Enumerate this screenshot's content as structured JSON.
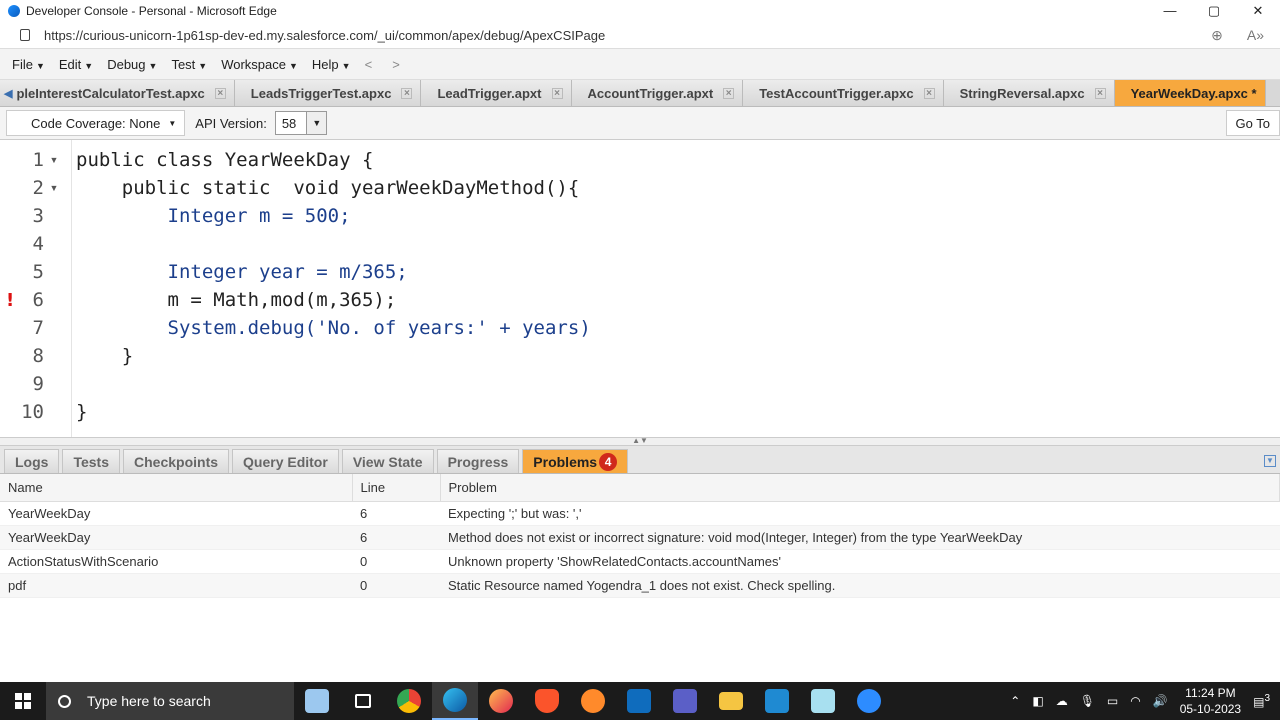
{
  "window": {
    "title": "Developer Console - Personal - Microsoft Edge",
    "controls": [
      "—",
      "▢",
      "✕"
    ]
  },
  "address": {
    "url": "https://curious-unicorn-1p61sp-dev-ed.my.salesforce.com/_ui/common/apex/debug/ApexCSIPage",
    "zoom_icon": "⊕",
    "read_icon": "A»"
  },
  "menu": {
    "items": [
      "File",
      "Edit",
      "Debug",
      "Test",
      "Workspace",
      "Help"
    ],
    "back": "<",
    "forward": ">"
  },
  "tabs": [
    {
      "label": "pleInterestCalculatorTest.apxc",
      "active": false
    },
    {
      "label": "LeadsTriggerTest.apxc",
      "active": false
    },
    {
      "label": "LeadTrigger.apxt",
      "active": false
    },
    {
      "label": "AccountTrigger.apxt",
      "active": false
    },
    {
      "label": "TestAccountTrigger.apxc",
      "active": false
    },
    {
      "label": "StringReversal.apxc",
      "active": false
    },
    {
      "label": "YearWeekDay.apxc *",
      "active": true
    }
  ],
  "toolbar": {
    "coverage": "Code Coverage: None",
    "api_label": "API Version:",
    "api_value": "58",
    "goto": "Go To"
  },
  "editor": {
    "line_numbers": [
      "1",
      "2",
      "3",
      "4",
      "5",
      "6",
      "7",
      "8",
      "9",
      "10"
    ],
    "error_marker": "!",
    "lines": [
      "public class YearWeekDay {",
      "    public static  void yearWeekDayMethod(){",
      "        Integer m = 500;",
      "",
      "        Integer year = m/365;",
      "        m = Math,mod(m,365);",
      "        System.debug('No. of years:' + years)",
      "    }",
      "",
      "}"
    ]
  },
  "panel": {
    "tabs": [
      "Logs",
      "Tests",
      "Checkpoints",
      "Query Editor",
      "View State",
      "Progress",
      "Problems"
    ],
    "problems_count": "4",
    "columns": [
      "Name",
      "Line",
      "Problem"
    ],
    "rows": [
      {
        "name": "YearWeekDay",
        "line": "6",
        "problem": "Expecting ';' but was: ','"
      },
      {
        "name": "YearWeekDay",
        "line": "6",
        "problem": "Method does not exist or incorrect signature: void mod(Integer, Integer) from the type YearWeekDay"
      },
      {
        "name": "ActionStatusWithScenario",
        "line": "0",
        "problem": "Unknown property 'ShowRelatedContacts.accountNames'"
      },
      {
        "name": "pdf",
        "line": "0",
        "problem": "Static Resource named Yogendra_1 does not exist. Check spelling."
      }
    ]
  },
  "taskbar": {
    "search_placeholder": "Type here to search",
    "apps": [
      "paint-icon",
      "task-view-icon",
      "chrome-icon",
      "edge-icon",
      "firefox-icon",
      "brave-icon",
      "sublime-icon",
      "outlook-icon",
      "teams-icon",
      "file-explorer-icon",
      "vscode-icon",
      "notepad-icon",
      "zoom-icon"
    ],
    "time": "11:24 PM",
    "date": "05-10-2023",
    "notification_count": "3"
  },
  "colors": {
    "active_tab": "#f7a83e",
    "error_badge": "#d0281b",
    "keyword": "#1c3f8c",
    "number": "#2a7a2a",
    "string": "#b5402f"
  }
}
